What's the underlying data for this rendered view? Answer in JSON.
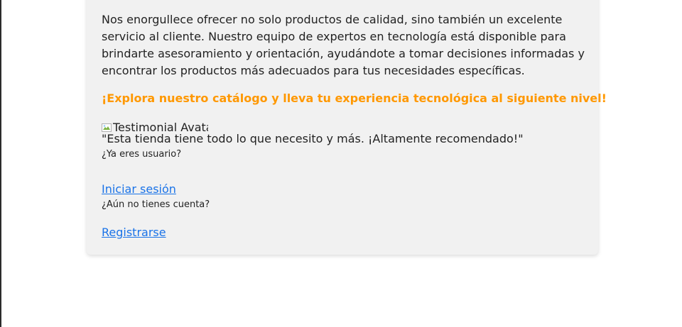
{
  "content": {
    "paragraph": "Nos enorgullece ofrecer no solo productos de calidad, sino también un excelente servicio al cliente. Nuestro equipo de expertos en tecnología está disponible para brindarte asesoramiento y orientación, ayudándote a tomar decisiones informadas y encontrar los productos más adecuados para tus necesidades específicas.",
    "cta": "¡Explora nuestro catálogo y lleva tu experiencia tecnológica al siguiente nivel!",
    "cta_color": "#ff9800"
  },
  "testimonial": {
    "avatar_alt": "Testimonial Avatar",
    "quote": "\"Esta tienda tiene todo lo que necesito y más. ¡Altamente recomendado!\""
  },
  "auth": {
    "login_prompt": "¿Ya eres usuario?",
    "login_link": "Iniciar sesión",
    "register_prompt": "¿Aún no tienes cuenta?",
    "register_link": "Registrarse",
    "link_color": "#1a73e8"
  }
}
